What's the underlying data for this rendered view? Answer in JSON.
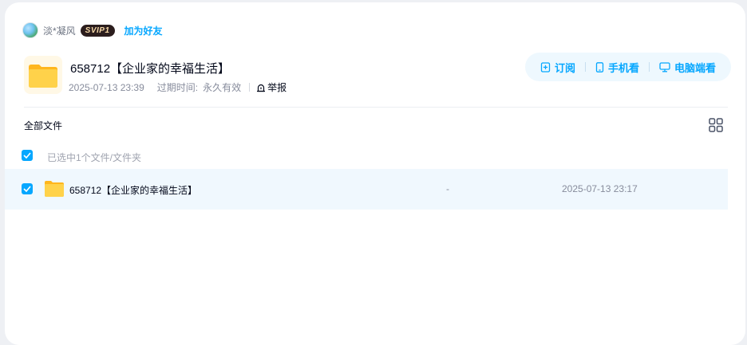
{
  "owner": {
    "name": "淡*凝风",
    "badge": "SVIP1",
    "add_friend": "加为好友"
  },
  "share": {
    "title": "658712【企业家的幸福生活】",
    "created": "2025-07-13 23:39",
    "expire_label": "过期时间:",
    "expire_value": "永久有效",
    "report": "举报"
  },
  "actions": {
    "subscribe": "订阅",
    "phone": "手机看",
    "pc": "电脑端看"
  },
  "breadcrumb": "全部文件",
  "selection": {
    "text": "已选中1个文件/文件夹"
  },
  "files": [
    {
      "name": "658712【企业家的幸福生活】",
      "size": "-",
      "date": "2025-07-13 23:17"
    }
  ],
  "colors": {
    "accent": "#06a7ff",
    "row_selected_bg": "#f0f8fe",
    "folder": "#ffc22e"
  }
}
